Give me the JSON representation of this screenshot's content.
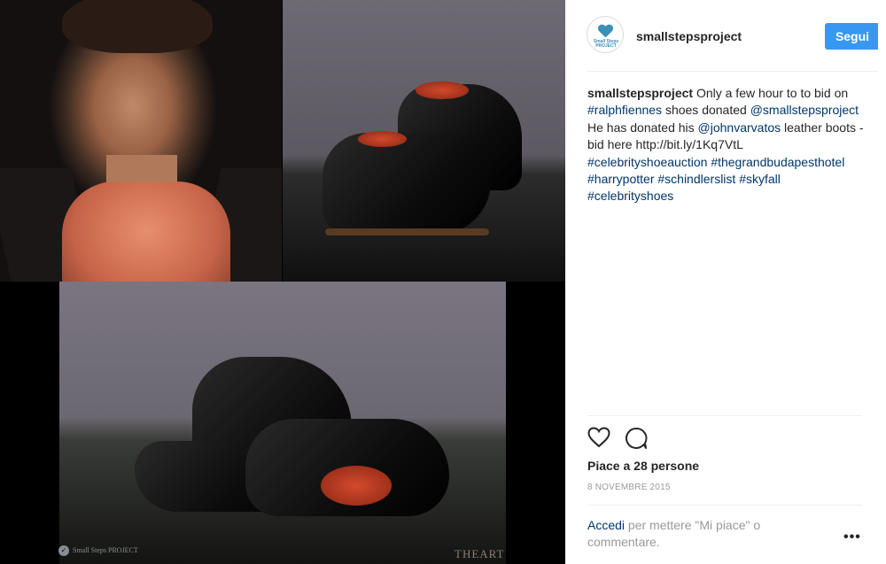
{
  "account": {
    "username": "smallstepsproject",
    "avatar_text": "Small Steps PROJECT",
    "follow_label": "Segui"
  },
  "caption": {
    "user": "smallstepsproject",
    "text_1": " Only a few hour to to bid on ",
    "tag_ralph": "#ralphfiennes",
    "text_2": " shoes donated ",
    "mention_sp": "@smallstepsproject",
    "text_3": " He has donated his ",
    "mention_jv": "@johnvarvatos",
    "text_4": " leather boots - bid here http://bit.ly/1Kq7VtL ",
    "tag_csa": "#celebrityshoeauction",
    "tag_gbh": "#thegrandbudapesthotel",
    "tag_hp": "#harrypotter",
    "tag_sl": "#schindlerslist",
    "tag_sf": "#skyfall",
    "tag_cs": "#celebrityshoes"
  },
  "likes": "Piace a 28 persone",
  "date": "8 NOVEMBRE 2015",
  "login": {
    "link": "Accedi",
    "rest": " per mettere \"Mi piace\" o commentare."
  },
  "more_label": "•••",
  "media": {
    "watermark_text": "Small Steps PROJECT",
    "heart_mark": "THEART"
  },
  "icons": {
    "like": "heart-outline-icon",
    "comment": "speech-bubble-icon",
    "more": "ellipsis-icon"
  },
  "colors": {
    "follow_button": "#3897f0",
    "link": "#003569",
    "muted": "#999999"
  }
}
